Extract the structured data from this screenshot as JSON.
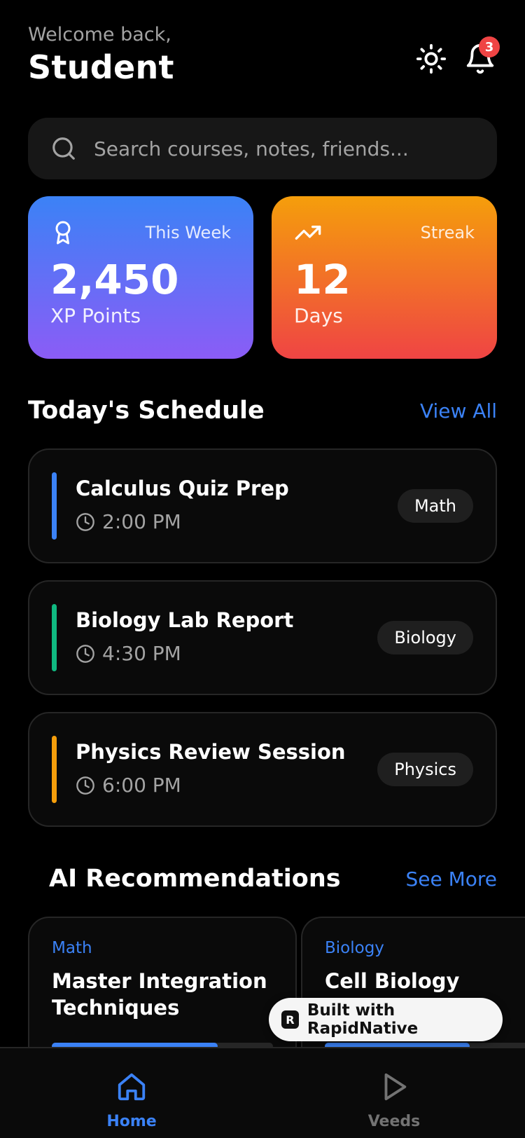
{
  "header": {
    "welcome": "Welcome back,",
    "username": "Student",
    "notification_count": "3"
  },
  "search": {
    "placeholder": "Search courses, notes, friends..."
  },
  "stats": [
    {
      "tag": "This Week",
      "value": "2,450",
      "label": "XP Points",
      "icon": "award-icon"
    },
    {
      "tag": "Streak",
      "value": "12",
      "label": "Days",
      "icon": "trending-up-icon"
    }
  ],
  "schedule": {
    "title": "Today's Schedule",
    "link": "View All",
    "items": [
      {
        "title": "Calculus Quiz Prep",
        "time": "2:00 PM",
        "subject": "Math",
        "color": "#3b82f6"
      },
      {
        "title": "Biology Lab Report",
        "time": "4:30 PM",
        "subject": "Biology",
        "color": "#10b981"
      },
      {
        "title": "Physics Review Session",
        "time": "6:00 PM",
        "subject": "Physics",
        "color": "#f59e0b"
      }
    ]
  },
  "recommendations": {
    "title": "AI Recommendations",
    "link": "See More",
    "items": [
      {
        "category": "Math",
        "title": "Master Integration Techniques",
        "progress": 0.75
      },
      {
        "category": "Biology",
        "title": "Cell Biology",
        "progress": 0.7
      }
    ]
  },
  "built_with": "Built with RapidNative",
  "tabbar": {
    "tabs": [
      {
        "label": "Home",
        "icon": "home-icon",
        "active": true
      },
      {
        "label": "Veeds",
        "icon": "play-icon",
        "active": false
      }
    ]
  },
  "colors": {
    "accent": "#3b82f6",
    "background": "#000000",
    "card": "#0a0a0a",
    "badge": "#ef4444"
  }
}
